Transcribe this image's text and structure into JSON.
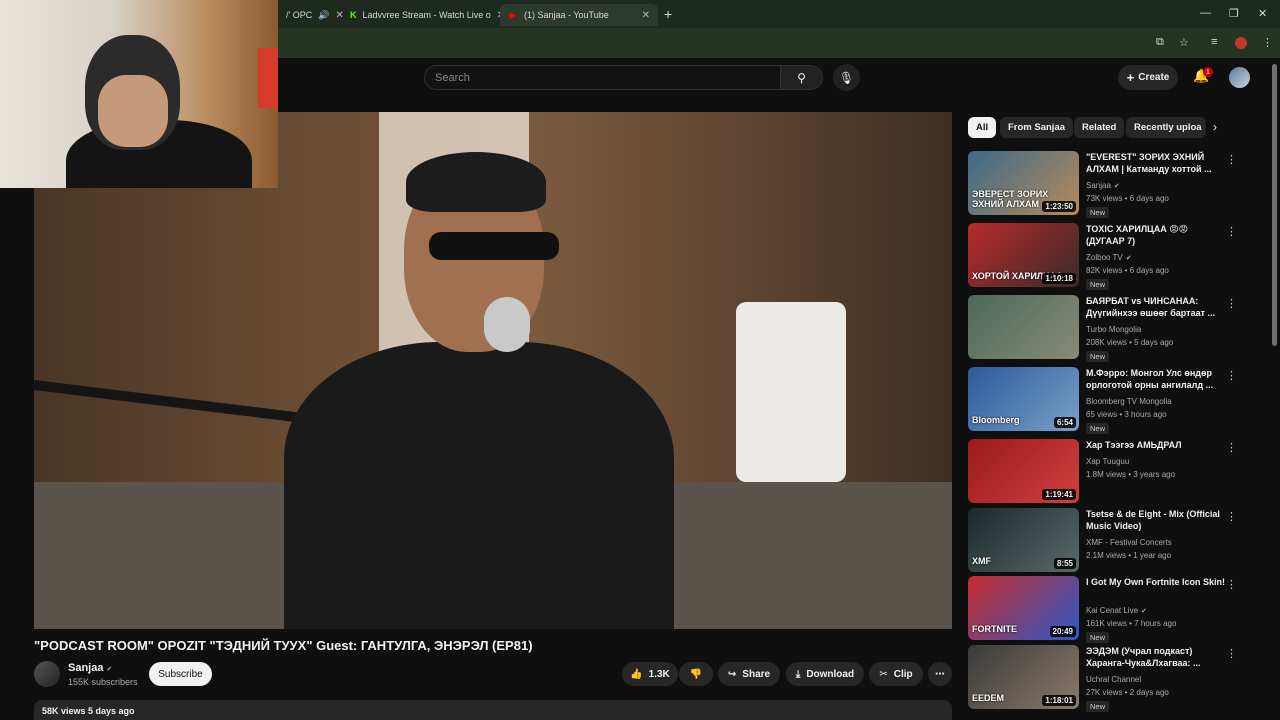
{
  "browser": {
    "tabs": [
      {
        "title": "/' OPC",
        "active": false
      },
      {
        "title": "Ladvvree Stream - Watch Live o",
        "active": false
      },
      {
        "title": "(1) Sanjaa - YouTube",
        "active": true
      }
    ]
  },
  "header": {
    "search_placeholder": "Search",
    "create_label": "Create",
    "notification_count": "1"
  },
  "video": {
    "title": "\"PODCAST ROOM\" OPOZIT \"ТЭДНИЙ ТУУХ\" Guest: ГАНТУЛГА, ЭНЭРЭЛ (EP81)",
    "channel": "Sanjaa",
    "subscribers": "155K subscribers",
    "subscribe_label": "Subscribe",
    "likes": "1.3K",
    "share_label": "Share",
    "download_label": "Download",
    "clip_label": "Clip",
    "views_date": "58K views  5 days ago"
  },
  "chips": [
    "All",
    "From Sanjaa",
    "Related",
    "Recently uploa"
  ],
  "recommendations": [
    {
      "title": "\"EVEREST\" ЗОРИХ ЭХНИЙ АЛХАМ | Катманду хоттой ...",
      "channel": "Sanjaa",
      "verified": true,
      "meta": "73K views • 6 days ago",
      "badge": "New",
      "duration": "1:23:50",
      "thumb_text": "ЭВЕРЕСТ ЗОРИХ ЭХНИЙ АЛХАМ",
      "color1": "#3a6a8a",
      "color2": "#b88a5a"
    },
    {
      "title": "TOXIC ХАРИЛЦАА 😡😡 (ДУГААР 7)",
      "channel": "Zolboo TV",
      "verified": true,
      "meta": "82K views • 6 days ago",
      "badge": "New",
      "duration": "1:10:18",
      "thumb_text": "ХОРТОЙ ХАРИЛЦАА",
      "color1": "#b82a2a",
      "color2": "#3a2a2a"
    },
    {
      "title": "БАЯРБАТ vs ЧИНСАНАА: Дүүгийнхээ өшөөг бартаат ...",
      "channel": "Turbo Mongolia",
      "verified": false,
      "meta": "208K views • 5 days ago",
      "badge": "New",
      "duration": "",
      "thumb_text": "",
      "color1": "#4a6a5a",
      "color2": "#8a8a7a"
    },
    {
      "title": "М.Фэрро: Монгол Улс өндөр орлоготой орны ангилалд ...",
      "channel": "Bloomberg TV Mongolia",
      "verified": false,
      "meta": "65 views • 3 hours ago",
      "badge": "New",
      "duration": "6:54",
      "thumb_text": "Bloomberg",
      "color1": "#2a5a9a",
      "color2": "#7aa0c8"
    },
    {
      "title": "Хар Тээгээ АМЬДРАЛ",
      "channel": "Хар Tuuguu",
      "verified": false,
      "meta": "1.8M views • 3 years ago",
      "badge": "",
      "duration": "1:19:41",
      "thumb_text": "",
      "color1": "#9a1a1a",
      "color2": "#d04040"
    },
    {
      "title": "Tsetse & de Eight - Mix (Official Music Video)",
      "channel": "XMF - Festival Concerts",
      "verified": false,
      "meta": "2.1M views • 1 year ago",
      "badge": "",
      "duration": "8:55",
      "thumb_text": "XMF",
      "color1": "#1a2a2a",
      "color2": "#5a6a6a"
    },
    {
      "title": "I Got My Own Fortnite Icon Skin!",
      "channel": "Kai Cenat Live",
      "verified": true,
      "meta": "161K views • 7 hours ago",
      "badge": "New",
      "duration": "20:49",
      "thumb_text": "FORTNITE",
      "color1": "#c82a2a",
      "color2": "#2a5ac8"
    },
    {
      "title": "ЭЭДЭМ (Учрал подкаст) Харанга-Чука&Лхагваа: ...",
      "channel": "Uchral Channel",
      "verified": false,
      "meta": "27K views • 2 days ago",
      "badge": "New",
      "duration": "1:18:01",
      "thumb_text": "EEDEM",
      "color1": "#3a3a3a",
      "color2": "#8a7a6a"
    }
  ]
}
